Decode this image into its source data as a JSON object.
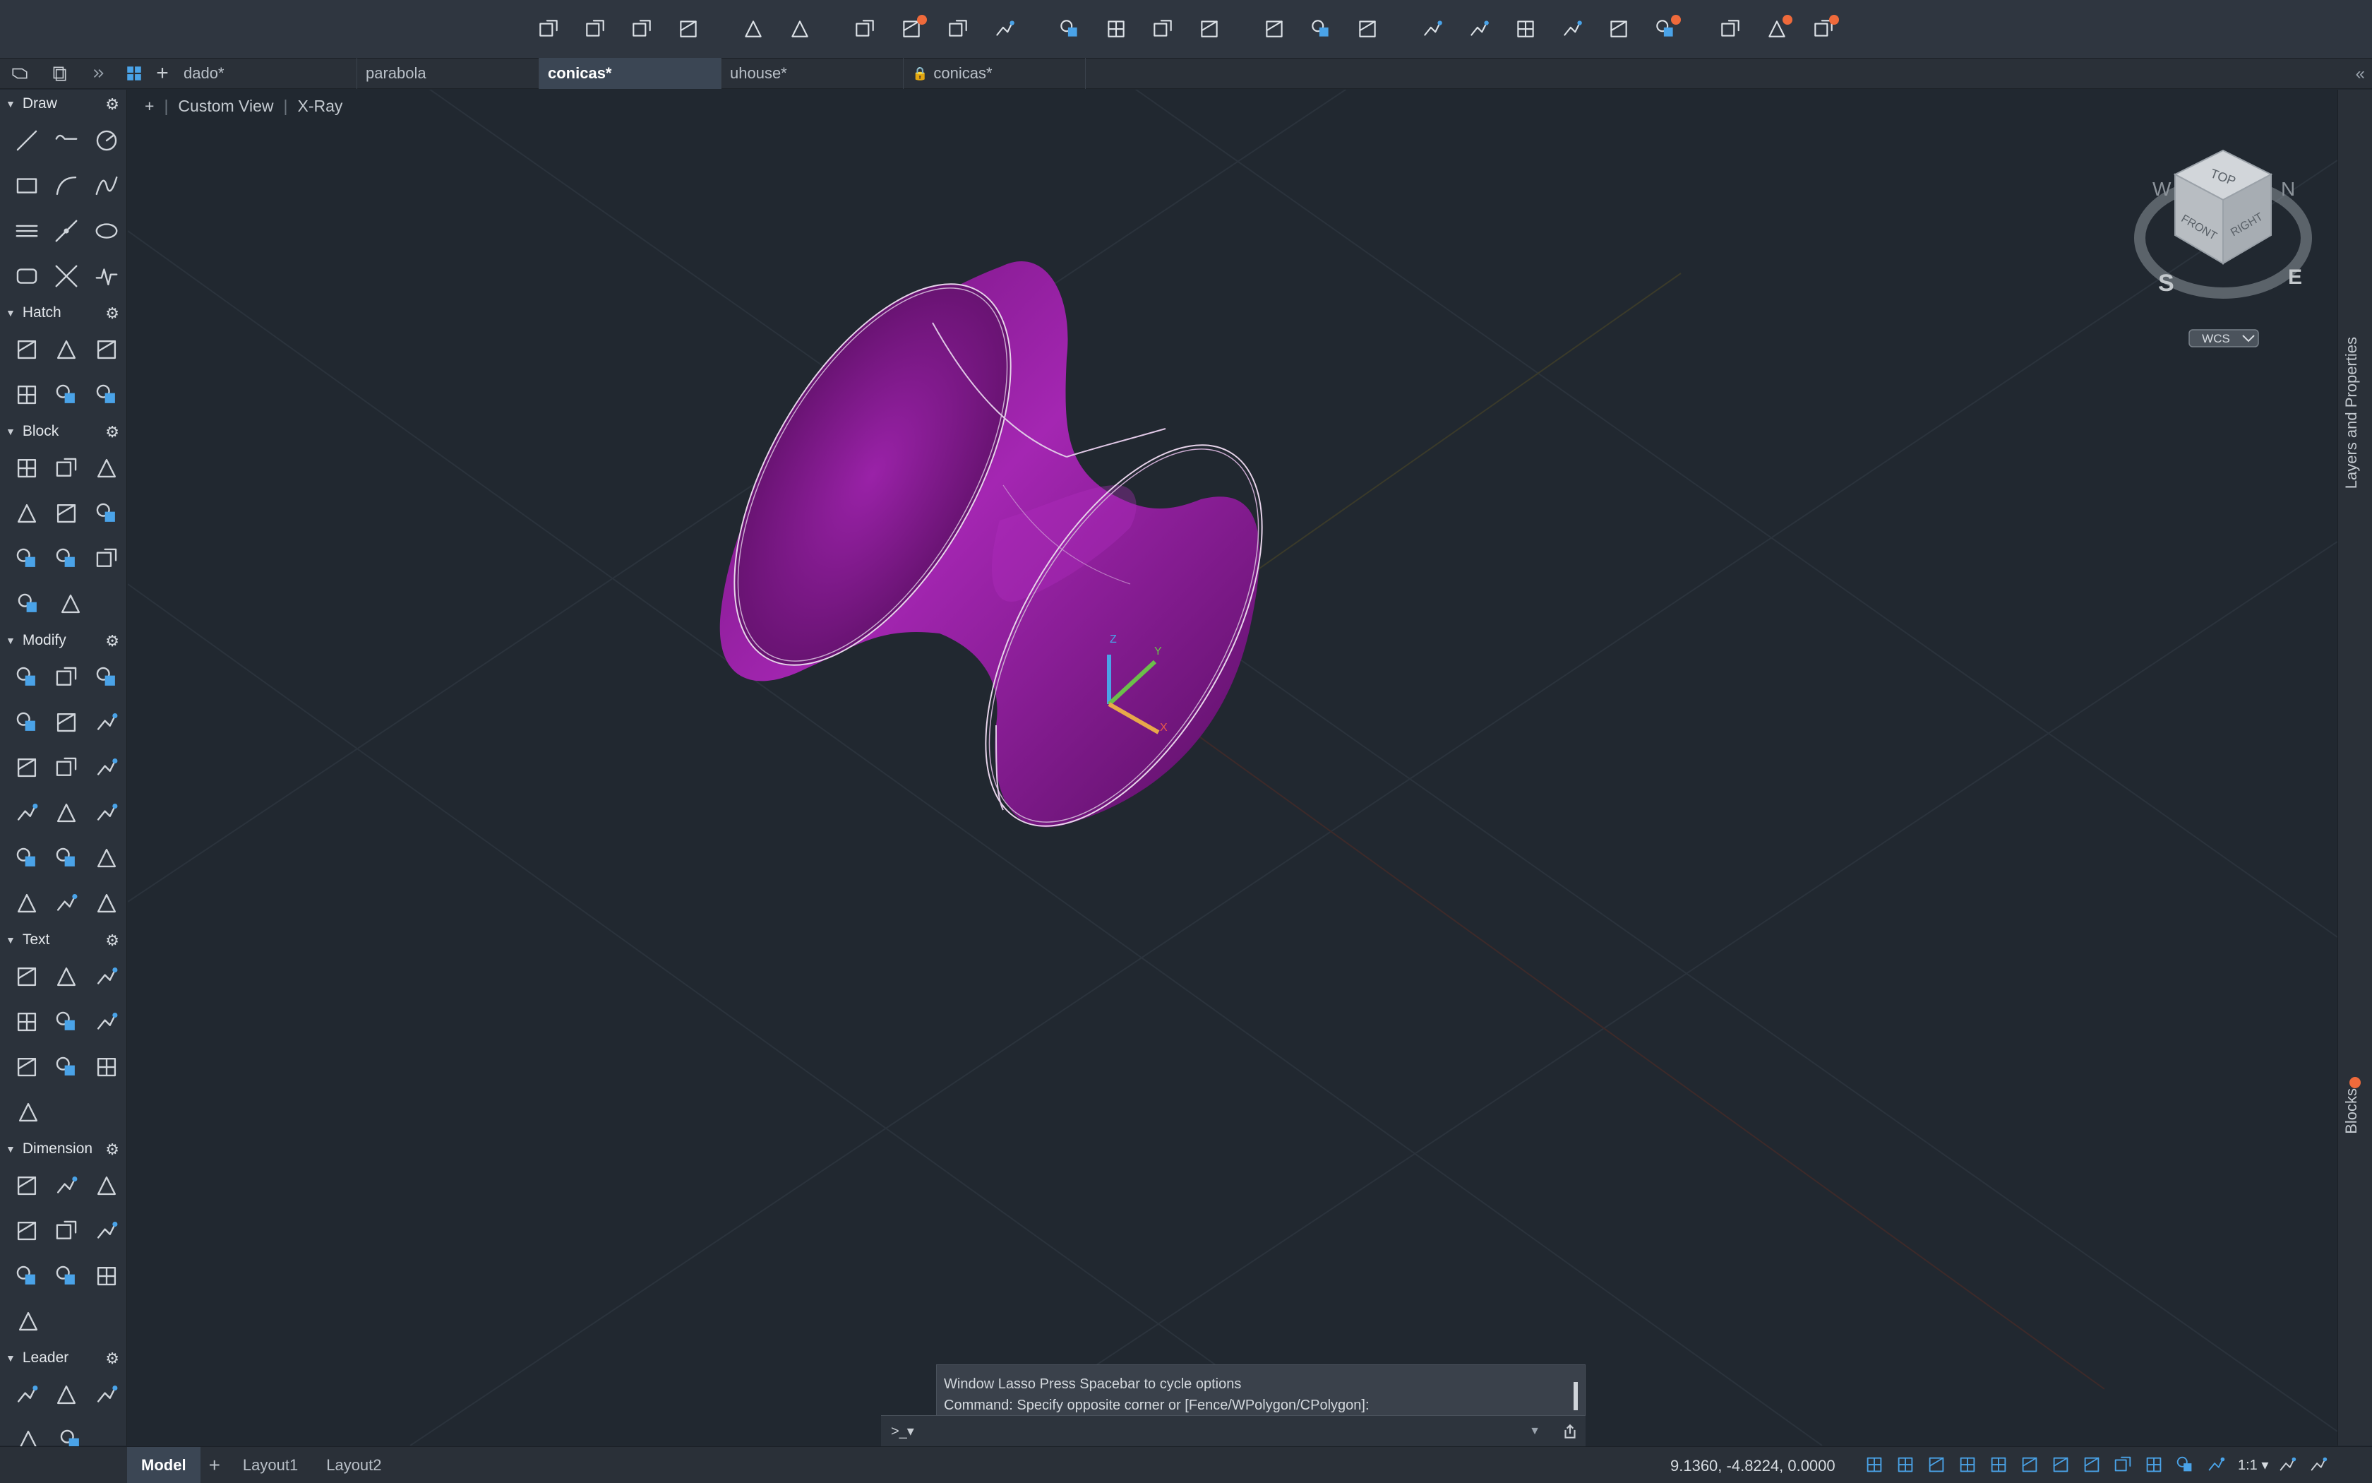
{
  "colors": {
    "accent": "#4aa3e8",
    "shape": "#8e1a98",
    "toolbar_bg": "#2f3640",
    "viewport_bg": "#212830",
    "notify": "#ef6a3b"
  },
  "toolbar": {
    "groups": [
      [
        {
          "icon": "new-file-icon"
        },
        {
          "icon": "open-folder-icon"
        },
        {
          "icon": "save-icon"
        },
        {
          "icon": "save-as-icon"
        }
      ],
      [
        {
          "icon": "undo-icon"
        },
        {
          "icon": "redo-icon"
        }
      ],
      [
        {
          "icon": "print-icon"
        },
        {
          "icon": "batch-plot-icon",
          "notify": true
        },
        {
          "icon": "page-setup-icon"
        },
        {
          "icon": "publish-icon"
        }
      ],
      [
        {
          "icon": "import-icon"
        },
        {
          "icon": "export-icon"
        },
        {
          "icon": "attach-icon"
        },
        {
          "icon": "ai-icon"
        }
      ],
      [
        {
          "icon": "zoom-window-icon"
        },
        {
          "icon": "pan-hand-icon"
        },
        {
          "icon": "orbit-icon"
        }
      ],
      [
        {
          "icon": "properties-icon"
        },
        {
          "icon": "match-icon"
        },
        {
          "icon": "web-globe-icon"
        },
        {
          "icon": "share-icon"
        },
        {
          "icon": "layout-icon"
        },
        {
          "icon": "cloud-icon",
          "notify": true
        }
      ],
      [
        {
          "icon": "compare-icon"
        },
        {
          "icon": "send-icon",
          "notify": true
        },
        {
          "icon": "mail-icon",
          "notify": true
        }
      ]
    ]
  },
  "tabs": [
    {
      "label": "dado*",
      "active": false,
      "locked": false
    },
    {
      "label": "parabola",
      "active": false,
      "locked": false
    },
    {
      "label": "conicas*",
      "active": true,
      "locked": false
    },
    {
      "label": "uhouse*",
      "active": false,
      "locked": false
    },
    {
      "label": "conicas*",
      "active": false,
      "locked": true
    }
  ],
  "tab_add": "+",
  "collapse_glyph": "«",
  "palette": {
    "sections": [
      {
        "title": "Draw",
        "rows": [
          [
            "line-icon",
            "polyline-icon",
            "circle-icon"
          ],
          [
            "rectangle-icon",
            "arc-icon",
            "spline-icon"
          ],
          [
            "multiline-icon",
            "construction-line-icon",
            "ellipse-icon"
          ],
          [
            "rect-round-icon",
            "trim-line-icon",
            "wave-icon"
          ]
        ]
      },
      {
        "title": "Hatch",
        "rows": [
          [
            "hatch-icon",
            "gradient-icon",
            "boundary-icon"
          ],
          [
            "region-icon",
            "wipeout-icon",
            "revision-cloud-icon"
          ]
        ]
      },
      {
        "title": "Block",
        "rows": [
          [
            "create-block-icon",
            "insert-block-icon",
            "edit-block-icon"
          ],
          [
            "define-attribute-icon",
            "tag-icon",
            "block-attributes-icon"
          ],
          [
            "block-base-icon",
            "write-block-icon",
            "block-palette-icon"
          ],
          [
            "attribute-edit-icon",
            "attribute-sync-icon"
          ]
        ]
      },
      {
        "title": "Modify",
        "rows": [
          [
            "move-icon",
            "copy-icon",
            "mirror-icon"
          ],
          [
            "rotate-icon",
            "scale-icon",
            "stretch-icon"
          ],
          [
            "fillet-icon",
            "offset-icon",
            "array-icon"
          ],
          [
            "3d-box-icon",
            "chamfer-icon",
            "explode-icon"
          ],
          [
            "align-icon",
            "break-icon",
            "join-icon"
          ],
          [
            "pedit-icon",
            "properties-match-icon",
            "lamp-icon"
          ]
        ]
      },
      {
        "title": "Text",
        "rows": [
          [
            "mtext-icon",
            "single-text-icon",
            "text-style-icon"
          ],
          [
            "edit-text-icon",
            "spell-check-icon",
            "find-text-icon"
          ],
          [
            "table-icon",
            "text-align-icon",
            "pdf-text-icon"
          ],
          [
            "pdf-import-icon"
          ]
        ]
      },
      {
        "title": "Dimension",
        "rows": [
          [
            "linear-dim-icon",
            "aligned-dim-icon",
            "baseline-dim-icon"
          ],
          [
            "continue-dim-icon",
            "radius-dim-icon",
            "tolerance-icon"
          ],
          [
            "ordinate-dim-icon",
            "dim-edit-icon",
            "dim-style-icon"
          ],
          [
            "dim-update-icon"
          ]
        ]
      },
      {
        "title": "Leader",
        "rows": [
          [
            "leader-icon",
            "multileader-icon",
            "leader-add-icon"
          ],
          [
            "leader-remove-icon",
            "leader-align-icon"
          ]
        ]
      }
    ]
  },
  "viewport": {
    "add": "+",
    "view_name": "Custom View",
    "visual_style": "X-Ray",
    "viewcube": {
      "top": "TOP",
      "front": "FRONT",
      "right": "RIGHT",
      "north": "N",
      "south": "S",
      "east": "E",
      "west": "W",
      "ucs": "WCS"
    },
    "ucs_axis": {
      "y": "Y",
      "z": "Z",
      "x": "X"
    }
  },
  "right_panels": [
    {
      "label": "Layers and Properties"
    },
    {
      "label": "Blocks",
      "notify": true
    }
  ],
  "command": {
    "history": [
      "Window Lasso  Press Spacebar to cycle options",
      "Command: Specify opposite corner or [Fence/WPolygon/CPolygon]:"
    ],
    "prompt_icon": ">_▾",
    "input_value": "",
    "placeholder": ""
  },
  "status": {
    "layouts": [
      {
        "label": "Model",
        "active": true
      },
      {
        "label": "Layout1",
        "active": false
      },
      {
        "label": "Layout2",
        "active": false
      }
    ],
    "layout_add": "+",
    "coords": "9.1360,  -4.8224, 0.0000",
    "icons": [
      "grid-icon",
      "snap-icon",
      "ortho-icon",
      "polar-icon",
      "isodraft-icon",
      "lineweight-icon",
      "transparency-icon",
      "selection-cycling-icon",
      "osnap-icon",
      "otrack-icon",
      "dynamic-ucs-icon",
      "annotation-icon"
    ],
    "scale": "1:1 ▾",
    "right_icons": [
      "workspace-icon",
      "settings-gear-icon"
    ]
  }
}
